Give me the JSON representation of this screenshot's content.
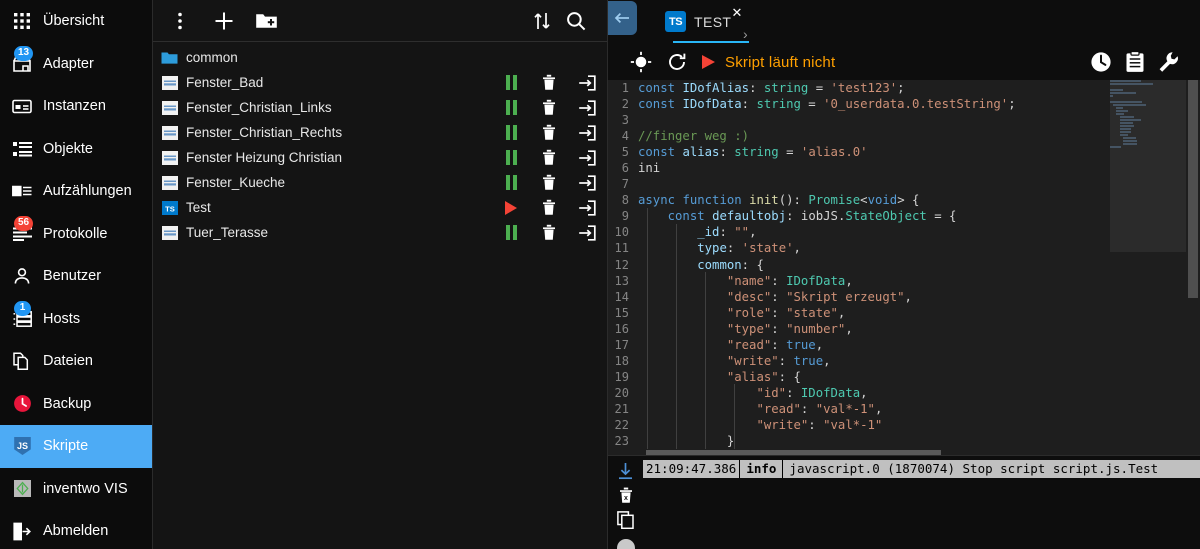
{
  "sidebar": {
    "items": [
      {
        "label": "Übersicht",
        "icon": "grid-icon",
        "badge": null,
        "active": false
      },
      {
        "label": "Adapter",
        "icon": "store-icon",
        "badge": "13",
        "badge_color": "blue",
        "active": false
      },
      {
        "label": "Instanzen",
        "icon": "card-icon",
        "badge": null,
        "active": false
      },
      {
        "label": "Objekte",
        "icon": "list-icon",
        "badge": null,
        "active": false
      },
      {
        "label": "Aufzählungen",
        "icon": "enum-icon",
        "badge": null,
        "active": false
      },
      {
        "label": "Protokolle",
        "icon": "logs-icon",
        "badge": "56",
        "badge_color": "red",
        "active": false
      },
      {
        "label": "Benutzer",
        "icon": "user-icon",
        "badge": null,
        "active": false
      },
      {
        "label": "Hosts",
        "icon": "hosts-icon",
        "badge": "1",
        "badge_color": "blue",
        "active": false
      },
      {
        "label": "Dateien",
        "icon": "files-icon",
        "badge": null,
        "active": false
      },
      {
        "label": "Backup",
        "icon": "backup-icon",
        "badge": null,
        "active": false
      },
      {
        "label": "Skripte",
        "icon": "js-icon",
        "badge": null,
        "active": true
      },
      {
        "label": "inventwo VIS",
        "icon": "vis-icon",
        "badge": null,
        "active": false
      },
      {
        "label": "Abmelden",
        "icon": "logout-icon",
        "badge": null,
        "active": false
      }
    ],
    "active_color": "#4dabf5"
  },
  "tree": {
    "toolbar": [
      {
        "name": "more-vert-icon",
        "label": "Mehr"
      },
      {
        "name": "add-icon",
        "label": "Neues Skript"
      },
      {
        "name": "new-folder-icon",
        "label": "Neuer Ordner"
      },
      {
        "name": "sort-icon",
        "label": "Sortieren"
      },
      {
        "name": "search-icon",
        "label": "Suchen"
      }
    ],
    "rows": [
      {
        "name": "common",
        "type": "folder",
        "actions": false
      },
      {
        "name": "Fenster_Bad",
        "type": "js",
        "actions": true,
        "state": "running"
      },
      {
        "name": "Fenster_Christian_Links",
        "type": "js",
        "actions": true,
        "state": "running"
      },
      {
        "name": "Fenster_Christian_Rechts",
        "type": "js",
        "actions": true,
        "state": "running"
      },
      {
        "name": "Fenster Heizung Christian",
        "type": "js",
        "actions": true,
        "state": "running"
      },
      {
        "name": "Fenster_Kueche",
        "type": "js",
        "actions": true,
        "state": "running"
      },
      {
        "name": "Test",
        "type": "ts",
        "actions": true,
        "state": "stopped"
      },
      {
        "name": "Tuer_Terasse",
        "type": "js",
        "actions": true,
        "state": "running"
      }
    ]
  },
  "editor": {
    "back_label": "←",
    "tab": {
      "badge": "TS",
      "label": "TEST",
      "close": "✕",
      "chevron": "›"
    },
    "runbar": {
      "target_icon": "crosshair-icon",
      "reload_icon": "reload-icon",
      "play_icon": "play-icon",
      "status": "Skript läuft nicht",
      "status_color": "#ffa000",
      "right_icons": [
        {
          "name": "clock-icon",
          "label": "Verlauf"
        },
        {
          "name": "clipboard-icon",
          "label": "Zwischenablage"
        },
        {
          "name": "wrench-icon",
          "label": "Einstellungen"
        }
      ]
    },
    "tooltip": "tab-javascript",
    "lines": [
      {
        "n": 1,
        "tokens": [
          {
            "t": "const",
            "c": "kw"
          },
          {
            "t": " ",
            "c": "pln"
          },
          {
            "t": "IDofAlias",
            "c": "id"
          },
          {
            "t": ": ",
            "c": "pln"
          },
          {
            "t": "string",
            "c": "typ"
          },
          {
            "t": " = ",
            "c": "pln"
          },
          {
            "t": "'test123'",
            "c": "str"
          },
          {
            "t": ";",
            "c": "pln"
          }
        ]
      },
      {
        "n": 2,
        "tokens": [
          {
            "t": "const",
            "c": "kw"
          },
          {
            "t": " ",
            "c": "pln"
          },
          {
            "t": "IDofData",
            "c": "id"
          },
          {
            "t": ": ",
            "c": "pln"
          },
          {
            "t": "string",
            "c": "typ"
          },
          {
            "t": " = ",
            "c": "pln"
          },
          {
            "t": "'0_userdata.0.testString'",
            "c": "str"
          },
          {
            "t": ";",
            "c": "pln"
          }
        ]
      },
      {
        "n": 3,
        "tokens": []
      },
      {
        "n": 4,
        "tokens": [
          {
            "t": "//finger weg :)",
            "c": "cmt"
          }
        ]
      },
      {
        "n": 5,
        "tokens": [
          {
            "t": "const",
            "c": "kw"
          },
          {
            "t": " ",
            "c": "pln"
          },
          {
            "t": "alias",
            "c": "id"
          },
          {
            "t": ": ",
            "c": "pln"
          },
          {
            "t": "string",
            "c": "typ"
          },
          {
            "t": " = ",
            "c": "pln"
          },
          {
            "t": "'alias.0'",
            "c": "str"
          }
        ]
      },
      {
        "n": 6,
        "tokens": [
          {
            "t": "ini",
            "c": "pln"
          }
        ]
      },
      {
        "n": 7,
        "tokens": []
      },
      {
        "n": 8,
        "tokens": [
          {
            "t": "async",
            "c": "kw"
          },
          {
            "t": " ",
            "c": "pln"
          },
          {
            "t": "function",
            "c": "kw"
          },
          {
            "t": " ",
            "c": "pln"
          },
          {
            "t": "init",
            "c": "fn"
          },
          {
            "t": "(): ",
            "c": "pln"
          },
          {
            "t": "Promise",
            "c": "typ"
          },
          {
            "t": "<",
            "c": "pln"
          },
          {
            "t": "void",
            "c": "kw"
          },
          {
            "t": "> {",
            "c": "pln"
          }
        ]
      },
      {
        "n": 9,
        "tokens": [
          {
            "t": "    ",
            "c": "pln"
          },
          {
            "t": "const",
            "c": "kw"
          },
          {
            "t": " ",
            "c": "pln"
          },
          {
            "t": "defaultobj",
            "c": "id"
          },
          {
            "t": ": ",
            "c": "pln"
          },
          {
            "t": "iobJS",
            "c": "pln"
          },
          {
            "t": ".",
            "c": "pln"
          },
          {
            "t": "StateObject",
            "c": "typ"
          },
          {
            "t": " = {",
            "c": "pln"
          }
        ]
      },
      {
        "n": 10,
        "tokens": [
          {
            "t": "        ",
            "c": "pln"
          },
          {
            "t": "_id",
            "c": "id"
          },
          {
            "t": ": ",
            "c": "pln"
          },
          {
            "t": "\"\"",
            "c": "str"
          },
          {
            "t": ",",
            "c": "pln"
          }
        ]
      },
      {
        "n": 11,
        "tokens": [
          {
            "t": "        ",
            "c": "pln"
          },
          {
            "t": "type",
            "c": "id"
          },
          {
            "t": ": ",
            "c": "pln"
          },
          {
            "t": "'state'",
            "c": "str"
          },
          {
            "t": ",",
            "c": "pln"
          }
        ]
      },
      {
        "n": 12,
        "tokens": [
          {
            "t": "        ",
            "c": "pln"
          },
          {
            "t": "common",
            "c": "id"
          },
          {
            "t": ": {",
            "c": "pln"
          }
        ]
      },
      {
        "n": 13,
        "tokens": [
          {
            "t": "            ",
            "c": "pln"
          },
          {
            "t": "\"name\"",
            "c": "str"
          },
          {
            "t": ": ",
            "c": "pln"
          },
          {
            "t": "IDofData",
            "c": "typ"
          },
          {
            "t": ",",
            "c": "pln"
          }
        ]
      },
      {
        "n": 14,
        "tokens": [
          {
            "t": "            ",
            "c": "pln"
          },
          {
            "t": "\"desc\"",
            "c": "str"
          },
          {
            "t": ": ",
            "c": "pln"
          },
          {
            "t": "\"Skript erzeugt\"",
            "c": "str"
          },
          {
            "t": ",",
            "c": "pln"
          }
        ]
      },
      {
        "n": 15,
        "tokens": [
          {
            "t": "            ",
            "c": "pln"
          },
          {
            "t": "\"role\"",
            "c": "str"
          },
          {
            "t": ": ",
            "c": "pln"
          },
          {
            "t": "\"state\"",
            "c": "str"
          },
          {
            "t": ",",
            "c": "pln"
          }
        ]
      },
      {
        "n": 16,
        "tokens": [
          {
            "t": "            ",
            "c": "pln"
          },
          {
            "t": "\"type\"",
            "c": "str"
          },
          {
            "t": ": ",
            "c": "pln"
          },
          {
            "t": "\"number\"",
            "c": "str"
          },
          {
            "t": ",",
            "c": "pln"
          }
        ]
      },
      {
        "n": 17,
        "tokens": [
          {
            "t": "            ",
            "c": "pln"
          },
          {
            "t": "\"read\"",
            "c": "str"
          },
          {
            "t": ": ",
            "c": "pln"
          },
          {
            "t": "true",
            "c": "kw"
          },
          {
            "t": ",",
            "c": "pln"
          }
        ]
      },
      {
        "n": 18,
        "tokens": [
          {
            "t": "            ",
            "c": "pln"
          },
          {
            "t": "\"write\"",
            "c": "str"
          },
          {
            "t": ": ",
            "c": "pln"
          },
          {
            "t": "true",
            "c": "kw"
          },
          {
            "t": ",",
            "c": "pln"
          }
        ]
      },
      {
        "n": 19,
        "tokens": [
          {
            "t": "            ",
            "c": "pln"
          },
          {
            "t": "\"alias\"",
            "c": "str"
          },
          {
            "t": ": {",
            "c": "pln"
          }
        ]
      },
      {
        "n": 20,
        "tokens": [
          {
            "t": "                ",
            "c": "pln"
          },
          {
            "t": "\"id\"",
            "c": "str"
          },
          {
            "t": ": ",
            "c": "pln"
          },
          {
            "t": "IDofData",
            "c": "typ"
          },
          {
            "t": ",",
            "c": "pln"
          }
        ]
      },
      {
        "n": 21,
        "tokens": [
          {
            "t": "                ",
            "c": "pln"
          },
          {
            "t": "\"read\"",
            "c": "str"
          },
          {
            "t": ": ",
            "c": "pln"
          },
          {
            "t": "\"val*-1\"",
            "c": "str"
          },
          {
            "t": ",",
            "c": "pln"
          }
        ]
      },
      {
        "n": 22,
        "tokens": [
          {
            "t": "                ",
            "c": "pln"
          },
          {
            "t": "\"write\"",
            "c": "str"
          },
          {
            "t": ": ",
            "c": "pln"
          },
          {
            "t": "\"val*-1\"",
            "c": "str"
          }
        ]
      },
      {
        "n": 23,
        "tokens": [
          {
            "t": "            }",
            "c": "pln"
          }
        ]
      }
    ]
  },
  "log": {
    "side_icons": [
      {
        "name": "download-icon",
        "label": "Herunterladen"
      },
      {
        "name": "clear-icon",
        "label": "Leeren"
      },
      {
        "name": "copy-icon",
        "label": "Kopieren"
      },
      {
        "name": "pause-circle-icon",
        "label": "Pause"
      }
    ],
    "entries": [
      {
        "time": "21:09:47.386",
        "severity": "info",
        "message": "javascript.0 (1870074) Stop script script.js.Test"
      }
    ]
  }
}
